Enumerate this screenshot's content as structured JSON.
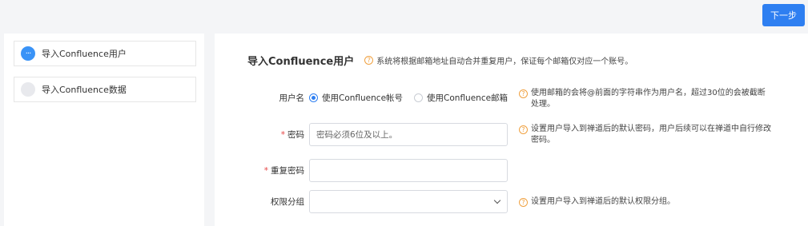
{
  "header": {
    "next_label": "下一步"
  },
  "sidebar": {
    "steps": [
      {
        "label": "导入Confluence用户",
        "marker": "···",
        "active": true
      },
      {
        "label": "导入Confluence数据",
        "marker": "···",
        "active": false
      }
    ]
  },
  "main": {
    "title": "导入Confluence用户",
    "title_hint": "系统将根据邮箱地址自动合并重复用户，保证每个邮箱仅对应一个账号。",
    "username": {
      "label": "用户名",
      "options": [
        {
          "label": "使用Confluence帐号",
          "checked": true
        },
        {
          "label": "使用Confluence邮箱",
          "checked": false
        }
      ],
      "hint": "使用邮箱的会将@前面的字符串作为用户名，超过30位的会被截断处理。"
    },
    "password": {
      "required_mark": "*",
      "label": "密码",
      "placeholder": "密码必须6位及以上。",
      "hint": "设置用户导入到禅道后的默认密码，用户后续可以在禅道中自行修改密码。"
    },
    "confirm_password": {
      "required_mark": "*",
      "label": "重复密码",
      "value": ""
    },
    "permission_group": {
      "label": "权限分组",
      "selected": "",
      "hint": "设置用户导入到禅道后的默认权限分组。"
    },
    "hint_icon_text": "?"
  },
  "colors": {
    "primary": "#2e7ff1",
    "hint_icon": "#f0a140",
    "required": "#e64545"
  }
}
